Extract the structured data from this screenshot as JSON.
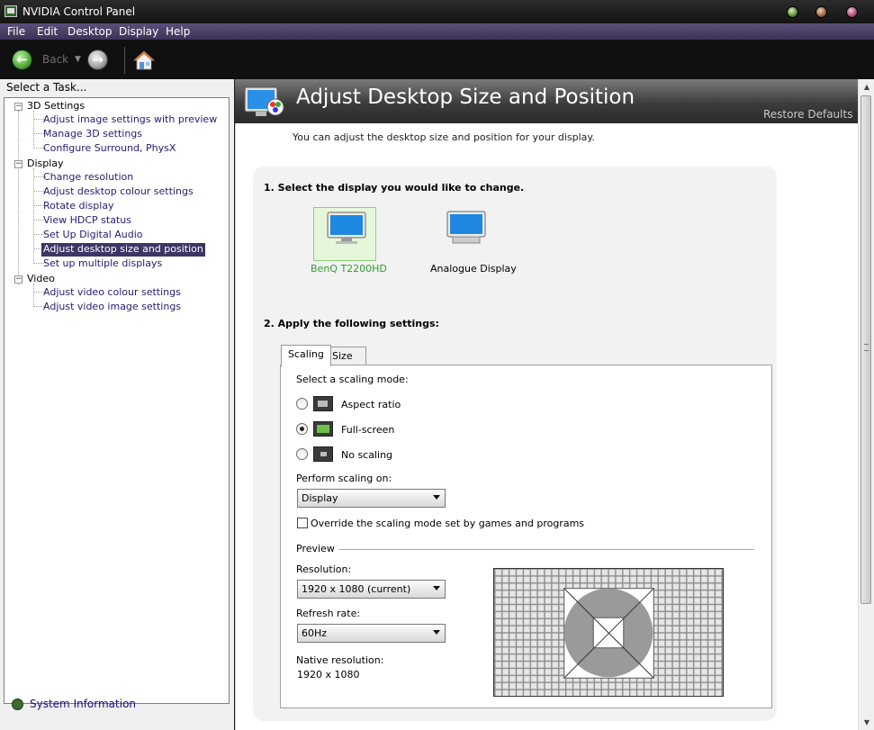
{
  "window": {
    "title": "NVIDIA Control Panel"
  },
  "menu": [
    "File",
    "Edit",
    "Desktop",
    "Display",
    "Help"
  ],
  "toolbar": {
    "back_label": "Back"
  },
  "sidebar": {
    "heading": "Select a Task...",
    "categories": [
      {
        "label": "3D Settings",
        "items": [
          "Adjust image settings with preview",
          "Manage 3D settings",
          "Configure Surround, PhysX"
        ]
      },
      {
        "label": "Display",
        "items": [
          "Change resolution",
          "Adjust desktop colour settings",
          "Rotate display",
          "View HDCP status",
          "Set Up Digital Audio",
          "Adjust desktop size and position",
          "Set up multiple displays"
        ]
      },
      {
        "label": "Video",
        "items": [
          "Adjust video colour settings",
          "Adjust video image settings"
        ]
      }
    ],
    "selected": "Adjust desktop size and position",
    "system_info": "System Information"
  },
  "page": {
    "title": "Adjust Desktop Size and Position",
    "restore_defaults": "Restore Defaults",
    "intro": "You can adjust the desktop size and position for your display.",
    "step1": "1. Select the display you would like to change.",
    "displays": [
      {
        "name": "BenQ T2200HD",
        "selected": true
      },
      {
        "name": "Analogue Display",
        "selected": false
      }
    ],
    "step2": "2. Apply the following settings:",
    "tabs": [
      "Scaling",
      "Size"
    ],
    "active_tab": "Scaling",
    "scaling_mode_label": "Select a scaling mode:",
    "scaling_modes": [
      {
        "label": "Aspect ratio",
        "checked": false
      },
      {
        "label": "Full-screen",
        "checked": true
      },
      {
        "label": "No scaling",
        "checked": false
      }
    ],
    "perform_on_label": "Perform scaling on:",
    "perform_on_value": "Display",
    "override_label": "Override the scaling mode set by games and programs",
    "override_checked": false,
    "preview_label": "Preview",
    "resolution_label": "Resolution:",
    "resolution_value": "1920 x 1080 (current)",
    "refresh_label": "Refresh rate:",
    "refresh_value": "60Hz",
    "native_label": "Native resolution:",
    "native_value": "1920 x 1080"
  },
  "colors": {
    "selected_bg": "#3d3565",
    "link": "#2a1a6e",
    "selected_display_text": "#2e9e2e"
  }
}
